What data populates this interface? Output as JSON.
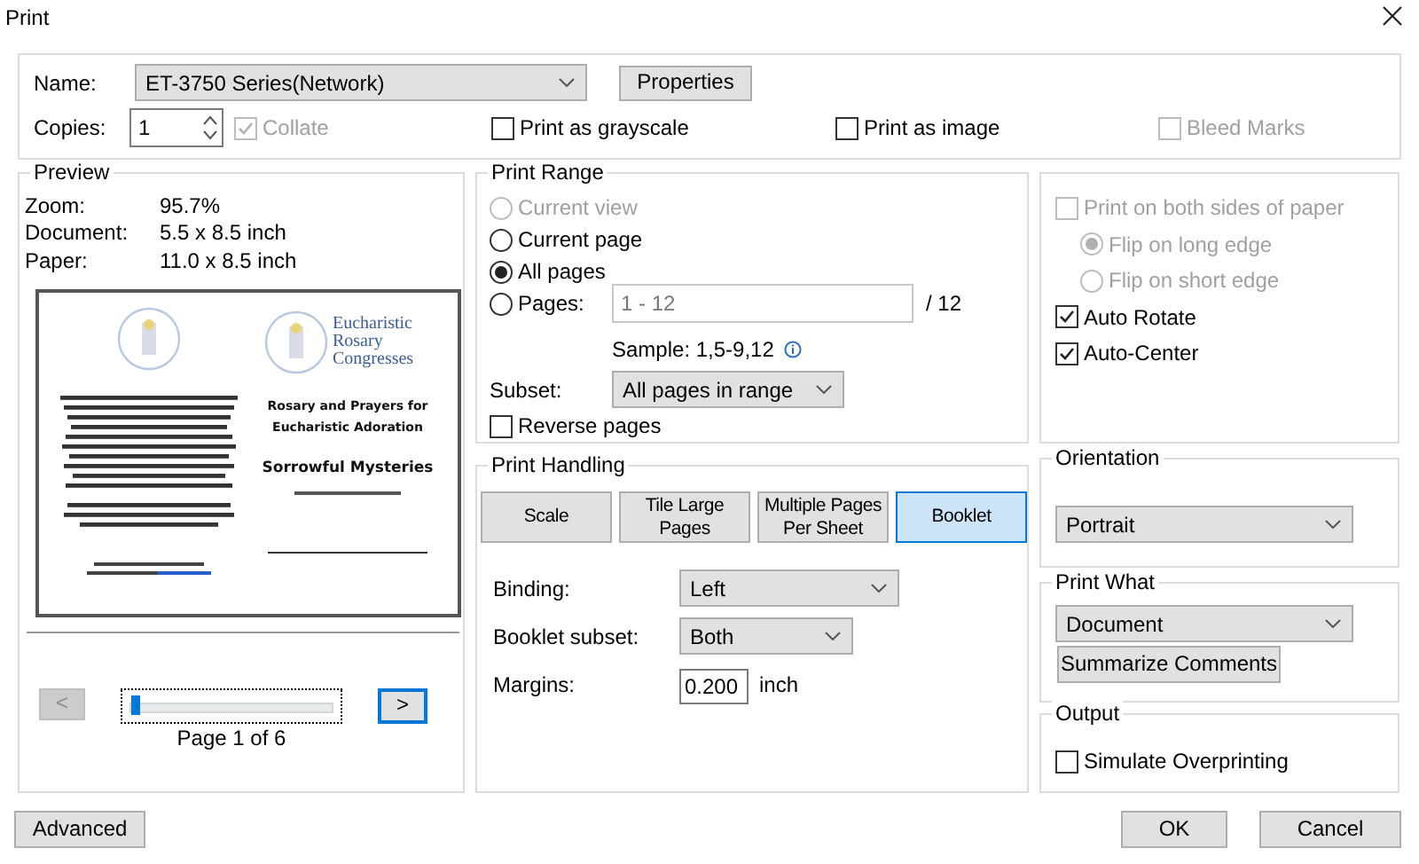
{
  "window": {
    "title": "Print"
  },
  "printer": {
    "name_label": "Name:",
    "name_value": "ET-3750 Series(Network)",
    "properties_button": "Properties",
    "copies_label": "Copies:",
    "copies_value": "1",
    "options": [
      {
        "label": "Collate",
        "checked": true,
        "disabled": true
      },
      {
        "label": "Print as grayscale",
        "checked": false,
        "disabled": false
      },
      {
        "label": "Print as image",
        "checked": false,
        "disabled": false
      },
      {
        "label": "Bleed Marks",
        "checked": false,
        "disabled": true
      }
    ]
  },
  "preview": {
    "title": "Preview",
    "info": [
      {
        "label": "Zoom:",
        "value": "95.7%"
      },
      {
        "label": "Document:",
        "value": "5.5 x 8.5 inch"
      },
      {
        "label": "Paper:",
        "value": "11.0 x 8.5 inch"
      }
    ],
    "page": {
      "logo_text": "Eucharistic Rosary Congresses",
      "headings": [
        "Rosary and Prayers for",
        "Eucharistic Adoration"
      ],
      "subtitle": "Sorrowful Mysteries"
    },
    "prev_button": {
      "label": "<",
      "disabled": true
    },
    "next_button": {
      "label": ">",
      "disabled": false
    },
    "slider": {
      "level": 0.0
    },
    "page_label": "Page 1 of 6"
  },
  "print_range": {
    "title": "Print Range",
    "options": [
      {
        "label": "Current view",
        "selected": false,
        "disabled": true
      },
      {
        "label": "Current page",
        "selected": false,
        "disabled": false
      },
      {
        "label": "All pages",
        "selected": true,
        "disabled": false
      },
      {
        "label": "Pages:",
        "selected": false,
        "disabled": false
      }
    ],
    "pages_value": "1 - 12",
    "pages_total": "/ 12",
    "sample": "Sample: 1,5-9,12",
    "subset_label": "Subset:",
    "subset_value": "All pages in range",
    "reverse": {
      "label": "Reverse pages",
      "checked": false
    }
  },
  "print_handling": {
    "title": "Print Handling",
    "modes": [
      {
        "label": "Scale",
        "selected": false
      },
      {
        "label": "Tile Large Pages",
        "selected": false
      },
      {
        "label": "Multiple Pages Per Sheet",
        "selected": false
      },
      {
        "label": "Booklet",
        "selected": true
      }
    ],
    "settings": [
      {
        "kind": "dropdown",
        "label": "Binding:",
        "value": "Left"
      },
      {
        "kind": "dropdown",
        "label": "Booklet subset:",
        "value": "Both"
      },
      {
        "kind": "input",
        "label": "Margins:",
        "value": "0.200",
        "unit": "inch"
      }
    ]
  },
  "duplex": {
    "options": [
      {
        "kind": "checkbox",
        "label": "Print on both sides of paper",
        "checked": false,
        "disabled": true
      },
      {
        "kind": "radio",
        "label": "Flip on long edge",
        "selected": true,
        "disabled": true
      },
      {
        "kind": "radio",
        "label": "Flip on short edge",
        "selected": false,
        "disabled": true
      },
      {
        "kind": "checkbox",
        "label": "Auto Rotate",
        "checked": true,
        "disabled": false
      },
      {
        "kind": "checkbox",
        "label": "Auto-Center",
        "checked": true,
        "disabled": false
      }
    ]
  },
  "orientation": {
    "title": "Orientation",
    "value": "Portrait"
  },
  "print_what": {
    "title": "Print What",
    "value": "Document",
    "button": "Summarize Comments"
  },
  "output": {
    "title": "Output",
    "options": [
      {
        "label": "Simulate Overprinting",
        "checked": false
      }
    ]
  },
  "footer": {
    "advanced": "Advanced",
    "ok": "OK",
    "cancel": "Cancel"
  }
}
